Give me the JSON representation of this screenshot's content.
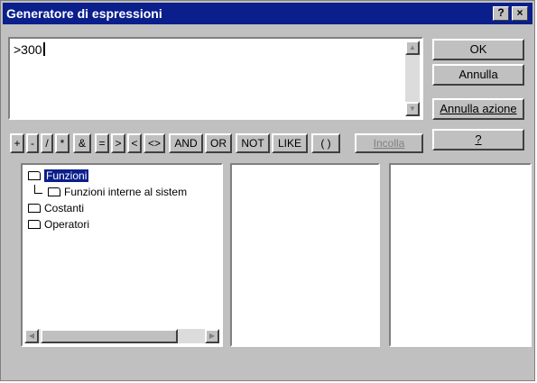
{
  "window": {
    "title": "Generatore di espressioni",
    "help_label": "?",
    "close_label": "×"
  },
  "expression": {
    "text": ">300"
  },
  "buttons": {
    "ok": "OK",
    "annulla": "Annulla",
    "annulla_azione": "Annulla azione",
    "help": "?"
  },
  "operators": [
    "+",
    "-",
    "/",
    "*",
    "&",
    "=",
    ">",
    "<",
    "<>",
    "AND",
    "OR",
    "NOT",
    "LIKE",
    "( )"
  ],
  "incolla": "Incolla",
  "tree": {
    "items": [
      {
        "label": "Funzioni",
        "icon": "open-folder-icon",
        "selected": true
      },
      {
        "label": "Funzioni interne al sistem",
        "icon": "folder-icon"
      },
      {
        "label": "Costanti",
        "icon": "folder-icon"
      },
      {
        "label": "Operatori",
        "icon": "folder-icon"
      }
    ]
  },
  "colors": {
    "title_bar": "#0a1e8c",
    "dialog_face": "#c0c0c0",
    "selection": "#0a1e8c"
  }
}
